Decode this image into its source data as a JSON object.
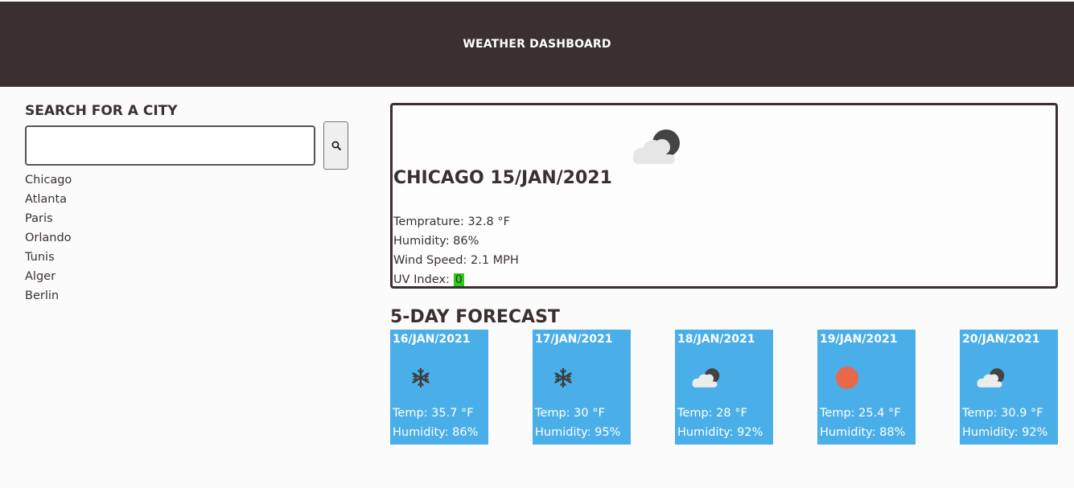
{
  "header": {
    "title": "WEATHER DASHBOARD"
  },
  "search": {
    "title": "SEARCH FOR A CITY",
    "input_value": "",
    "placeholder": "",
    "button_icon": "search-icon"
  },
  "history": [
    "Chicago",
    "Atlanta",
    "Paris",
    "Orlando",
    "Tunis",
    "Alger",
    "Berlin"
  ],
  "current": {
    "icon": "partly-cloudy-night-icon",
    "title": "CHICAGO 15/JAN/2021",
    "temperature": "Temprature: 32.8 °F",
    "humidity": "Humidity: 86%",
    "wind": "Wind Speed: 2.1 MPH",
    "uv_label": "UV Index: ",
    "uv_value": "0",
    "uv_color": "#2ecc1a"
  },
  "forecast": {
    "title": "5-DAY FORECAST",
    "days": [
      {
        "date": "16/JAN/2021",
        "icon": "snowflake-icon",
        "temp": "Temp: 35.7 °F",
        "humidity": "Humidity: 86%"
      },
      {
        "date": "17/JAN/2021",
        "icon": "snowflake-icon",
        "temp": "Temp: 30 °F",
        "humidity": "Humidity: 95%"
      },
      {
        "date": "18/JAN/2021",
        "icon": "partly-cloudy-night-icon",
        "temp": "Temp: 28 °F",
        "humidity": "Humidity: 92%"
      },
      {
        "date": "19/JAN/2021",
        "icon": "sun-icon",
        "temp": "Temp: 25.4 °F",
        "humidity": "Humidity: 88%"
      },
      {
        "date": "20/JAN/2021",
        "icon": "partly-cloudy-night-icon",
        "temp": "Temp: 30.9 °F",
        "humidity": "Humidity: 92%"
      }
    ]
  },
  "colors": {
    "header_bg": "#3b302f",
    "card_bg": "#4aafe8",
    "sun": "#e8694a"
  }
}
